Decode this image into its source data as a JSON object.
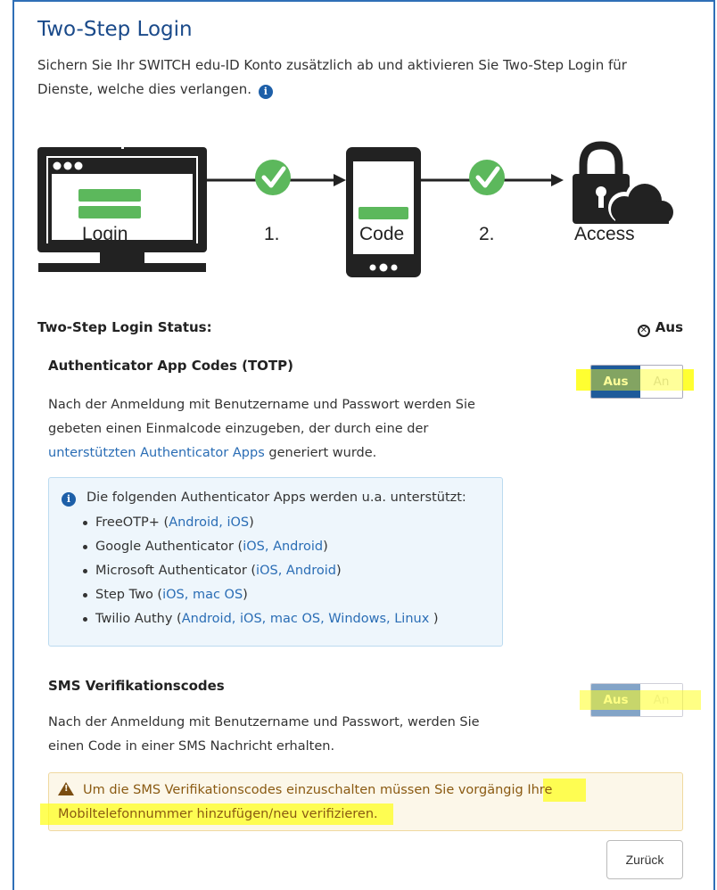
{
  "header": {
    "title": "Two-Step Login",
    "subtitle": "Sichern Sie Ihr SWITCH edu-ID Konto zusätzlich ab und aktivieren Sie Two-Step Login für Dienste, welche dies verlangen."
  },
  "diagram": {
    "login_label": "Login",
    "step1_label": "1.",
    "code_label": "Code",
    "step2_label": "2.",
    "access_label": "Access"
  },
  "status": {
    "label": "Two-Step Login Status:",
    "value": "Aus"
  },
  "totp": {
    "title": "Authenticator App Codes (TOTP)",
    "text_before_link": "Nach der Anmeldung mit Benutzername und Passwort werden Sie gebeten einen Einmalcode einzugeben, der durch eine der ",
    "link": "unterstützten Authenticator Apps",
    "text_after_link": " generiert wurde.",
    "toggle_off": "Aus",
    "toggle_on": "An"
  },
  "apps_box": {
    "heading": "Die folgenden Authenticator Apps werden u.a. unterstützt:",
    "items": [
      {
        "name": "FreeOTP+ (",
        "links": "Android, iOS",
        "end": ")"
      },
      {
        "name": "Google Authenticator (",
        "links": "iOS, Android",
        "end": ")"
      },
      {
        "name": "Microsoft Authenticator (",
        "links": "iOS, Android",
        "end": ")"
      },
      {
        "name": "Step Two (",
        "links": "iOS, mac OS",
        "end": ")"
      },
      {
        "name": "Twilio Authy (",
        "links": "Android, iOS, mac OS, Windows, Linux ",
        "end": ")"
      }
    ]
  },
  "sms": {
    "title": "SMS Verifikationscodes",
    "text": "Nach der Anmeldung mit Benutzername und Passwort, werden Sie einen Code in einer SMS Nachricht erhalten.",
    "toggle_off": "Aus",
    "toggle_on": "An"
  },
  "warning": {
    "text": "Um die SMS Verifikationscodes einzuschalten müssen Sie vorgängig ",
    "link": "Ihre Mobiltelefonnummer hinzufügen/neu verifizieren",
    "end": "."
  },
  "back_button": "Zurück",
  "colors": {
    "primary": "#1e5a9a",
    "check_green": "#5cb85c",
    "highlight": "#ffff1f"
  }
}
